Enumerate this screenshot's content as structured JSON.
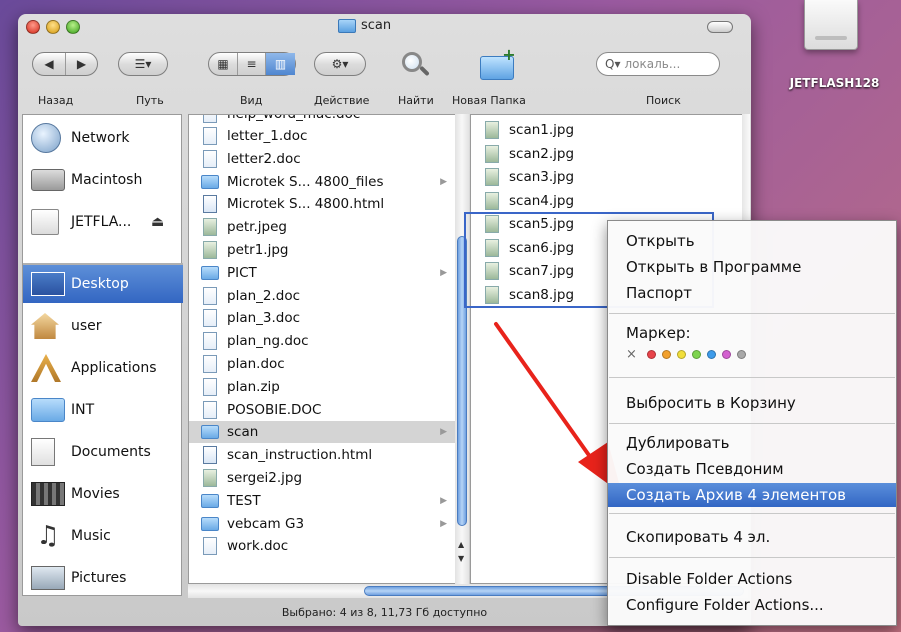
{
  "desktop": {
    "drive_label": "JETFLASH128"
  },
  "window": {
    "title": "scan",
    "toolbar": {
      "back_label": "Назад",
      "path_label": "Путь",
      "view_label": "Вид",
      "action_label": "Действие",
      "find_label": "Найти",
      "new_folder_label": "Новая Папка",
      "search_label": "Поиск",
      "search_placeholder": "локаль..."
    },
    "sidebar": {
      "items": [
        {
          "label": "Network",
          "icon": "network-globe-icon"
        },
        {
          "label": "Macintosh",
          "icon": "hard-drive-icon"
        },
        {
          "label": "JETFLA...",
          "icon": "usb-drive-icon",
          "eject": "⏏"
        },
        {
          "label": "Desktop",
          "icon": "desktop-icon",
          "selected": true
        },
        {
          "label": "user",
          "icon": "home-icon"
        },
        {
          "label": "Applications",
          "icon": "applications-icon"
        },
        {
          "label": "INT",
          "icon": "folder-icon"
        },
        {
          "label": "Documents",
          "icon": "documents-icon"
        },
        {
          "label": "Movies",
          "icon": "movies-icon"
        },
        {
          "label": "Music",
          "icon": "music-icon"
        },
        {
          "label": "Pictures",
          "icon": "pictures-icon"
        }
      ]
    },
    "column1": {
      "partial_top": "help_word_mac.doc",
      "items": [
        {
          "name": "letter_1.doc",
          "kind": "doc"
        },
        {
          "name": "letter2.doc",
          "kind": "doc"
        },
        {
          "name": "Microtek S... 4800_files",
          "kind": "folder",
          "arrow": true
        },
        {
          "name": "Microtek S... 4800.html",
          "kind": "html"
        },
        {
          "name": "petr.jpeg",
          "kind": "img"
        },
        {
          "name": "petr1.jpg",
          "kind": "img"
        },
        {
          "name": "PICT",
          "kind": "folder",
          "arrow": true
        },
        {
          "name": "plan_2.doc",
          "kind": "doc"
        },
        {
          "name": "plan_3.doc",
          "kind": "doc"
        },
        {
          "name": "plan_ng.doc",
          "kind": "doc"
        },
        {
          "name": "plan.doc",
          "kind": "doc"
        },
        {
          "name": "plan.zip",
          "kind": "doc"
        },
        {
          "name": "POSOBIE.DOC",
          "kind": "doc"
        },
        {
          "name": "scan",
          "kind": "folder",
          "arrow": true,
          "selected": true
        },
        {
          "name": "scan_instruction.html",
          "kind": "html"
        },
        {
          "name": "sergei2.jpg",
          "kind": "img"
        },
        {
          "name": "TEST",
          "kind": "folder",
          "arrow": true
        },
        {
          "name": "vebcam G3",
          "kind": "folder",
          "arrow": true
        },
        {
          "name": "work.doc",
          "kind": "doc"
        }
      ]
    },
    "column2": {
      "items": [
        {
          "name": "scan1.jpg"
        },
        {
          "name": "scan2.jpg"
        },
        {
          "name": "scan3.jpg"
        },
        {
          "name": "scan4.jpg"
        },
        {
          "name": "scan5.jpg"
        },
        {
          "name": "scan6.jpg"
        },
        {
          "name": "scan7.jpg"
        },
        {
          "name": "scan8.jpg"
        }
      ]
    },
    "status_text": "Выбрано: 4 из 8, 11,73 Гб доступно"
  },
  "context_menu": {
    "items": [
      "Открыть",
      "Открыть в Программе",
      "Паспорт",
      "Маркер:",
      "Выбросить в Корзину",
      "Дублировать",
      "Создать Псевдоним",
      "Создать Архив 4 элементов",
      "Скопировать 4 эл.",
      "Disable Folder Actions",
      "Configure Folder Actions..."
    ],
    "highlighted_index": 7,
    "label_none": "×",
    "label_colors": [
      "#e8434a",
      "#f2a02c",
      "#f1de3a",
      "#7ed44e",
      "#3d9bea",
      "#d361d0",
      "#a8a8a8"
    ]
  }
}
